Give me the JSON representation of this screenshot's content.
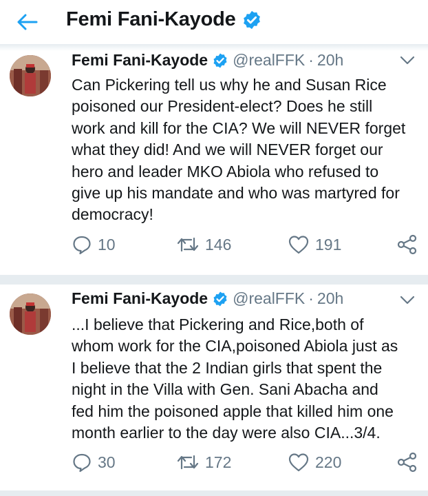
{
  "header": {
    "title": "Femi Fani-Kayode",
    "back_icon": "arrow-left-icon",
    "accent": "#1da1f2"
  },
  "tweets": [
    {
      "name": "Femi Fani-Kayode",
      "handle": "@realFFK",
      "separator": "·",
      "time": "20h",
      "text": "Can Pickering tell us why he and Susan Rice\npoisoned our President-elect? Does he still\nwork and kill for the CIA? We will NEVER forget\nwhat they did! And we will NEVER forget our\nhero and leader MKO Abiola who refused to\ngive up his mandate and who was martyred for\ndemocracy!",
      "replies": "10",
      "retweets": "146",
      "likes": "191"
    },
    {
      "name": "Femi Fani-Kayode",
      "handle": "@realFFK",
      "separator": "·",
      "time": "20h",
      "text": "...I believe that Pickering and Rice,both of\nwhom work for the CIA,poisoned Abiola just as\nI believe that the 2 Indian girls that spent the\nnight in the Villa with Gen. Sani Abacha and\nfed him the poisoned apple that killed him one\nmonth earlier to the day were also CIA...3/4.",
      "replies": "30",
      "retweets": "172",
      "likes": "220"
    }
  ],
  "colors": {
    "text": "#14171a",
    "muted": "#657786",
    "verified": "#1da1f2",
    "divider": "#e6ecf0"
  }
}
